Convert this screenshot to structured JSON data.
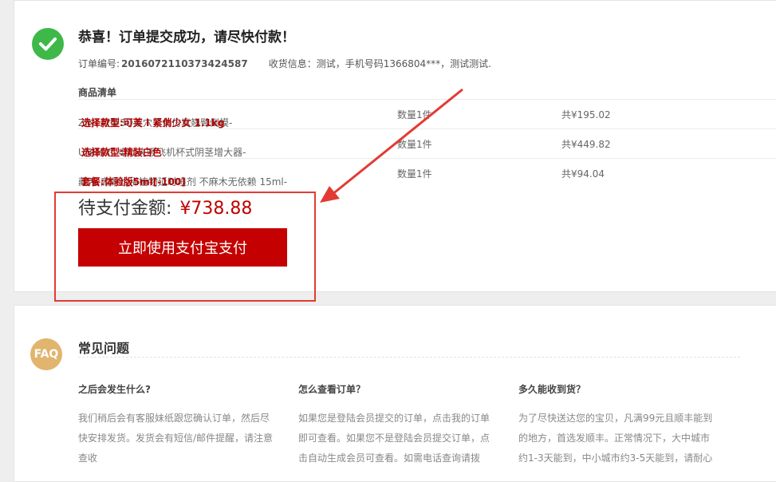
{
  "order": {
    "title": "恭喜！订单提交成功，请尽快付款！",
    "order_no_label": "订单编号:",
    "order_no": "2016072110373424587",
    "receiver": "收货信息：测试，手机号码1366804***，测试测试.",
    "list_header": "商品清单",
    "items": [
      {
        "name": "ZINI 可芙3D双穴美女仿真翘臀倒模-",
        "option": "选择款型:可芙 I 紧俏少女 1.1kg",
        "qty": "数量1件",
        "price": "共¥195.02"
      },
      {
        "name": "UNIMAT 电动夹吸飞机杯式阴茎增大器-",
        "option": "选择款型:精装白色",
        "qty": "数量1件",
        "price": "共¥449.82"
      },
      {
        "name": "藏帝 高原珍稀植物延时喷剂 不麻木无依赖 15ml-",
        "option": "套餐:体验版5ml[-100]",
        "qty": "数量1件",
        "price": "共¥94.04"
      }
    ],
    "pay_label": "待支付金额:",
    "pay_amount": "¥738.88",
    "pay_button": "立即使用支付宝支付"
  },
  "faq": {
    "badge": "FAQ",
    "title": "常见问题",
    "questions": [
      {
        "q": "之后会发生什么?",
        "a": "我们稍后会有客服妹纸跟您确认订单，然后尽快安排发货。发货会有短信/邮件提醒，请注意查收"
      },
      {
        "q": "怎么查看订单？",
        "a": "如果您是登陆会员提交的订单，点击我的订单即可查看。如果您不是登陆会员提交订单，点击自动生成会员可查看。如需电话查询请拨"
      },
      {
        "q": "多久能收到货？",
        "a": "为了尽快送达您的宝贝，凡满99元且顺丰能到的地方，首选发顺丰。正常情况下，大中城市约1-3天能到，中小城市约3-5天能到，请耐心"
      }
    ]
  },
  "colors": {
    "accent": "#c40000",
    "success": "#3fb84a",
    "faq_badge": "#e1b56d",
    "annotation": "#e23b33"
  }
}
